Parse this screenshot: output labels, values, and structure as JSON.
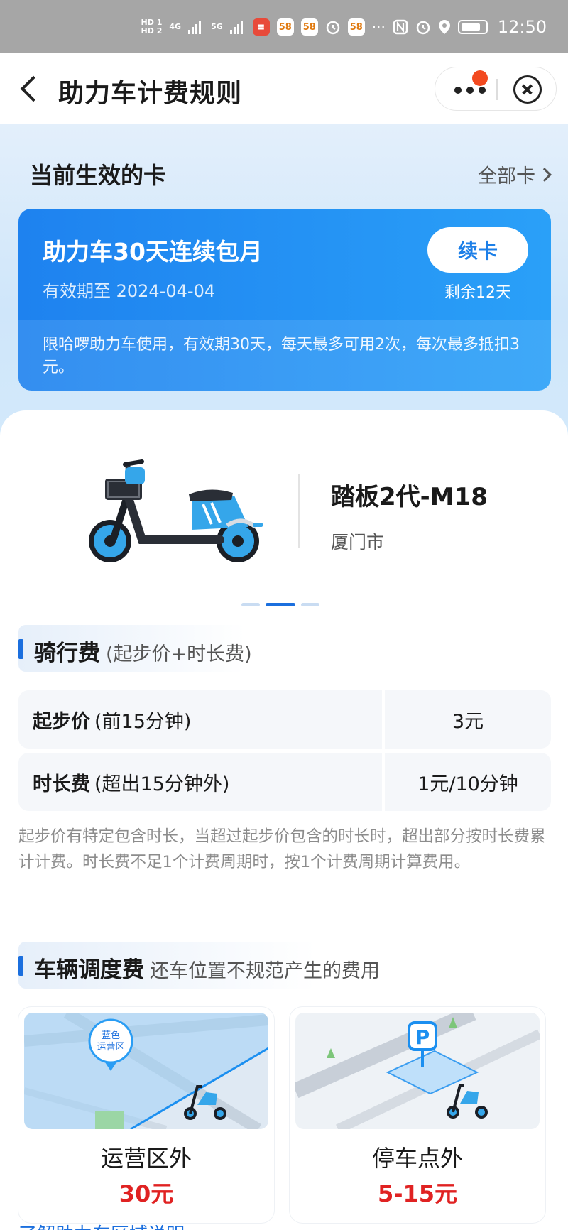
{
  "status_bar": {
    "hd1": "HD 1",
    "hd2": "HD 2",
    "net1": "4G",
    "net2": "5G",
    "app_badges": [
      "58",
      "58",
      "58"
    ],
    "more": "···",
    "time": "12:50"
  },
  "nav": {
    "title": "助力车计费规则"
  },
  "active_card": {
    "heading": "当前生效的卡",
    "all_cards_label": "全部卡",
    "title": "助力车30天连续包月",
    "valid_until": "有效期至 2024-04-04",
    "renew_label": "续卡",
    "remaining": "剩余12天",
    "description": "限哈啰助力车使用，有效期30天，每天最多可用2次，每次最多抵扣3元。"
  },
  "vehicle": {
    "model": "踏板2代-M18",
    "city": "厦门市"
  },
  "carousel": {
    "count": 3,
    "active_index": 1
  },
  "riding_fee": {
    "title": "骑行费",
    "subtitle": "(起步价+时长费)",
    "rows": [
      {
        "name": "起步价",
        "detail": "(前15分钟)",
        "value": "3元"
      },
      {
        "name": "时长费",
        "detail": "(超出15分钟外)",
        "value": "1元/10分钟"
      }
    ],
    "note": "起步价有特定包含时长，当超过起步价包含的时长时，超出部分按时长费累计计费。时长费不足1个计费周期时，按1个计费周期计算费用。"
  },
  "dispatch_fee": {
    "title": "车辆调度费",
    "subtitle": "还车位置不规范产生的费用",
    "cards": [
      {
        "name": "运营区外",
        "price": "30元",
        "map_label": "蓝色运营区",
        "icon": "map-pin-icon"
      },
      {
        "name": "停车点外",
        "price": "5-15元",
        "map_label": "P",
        "icon": "parking-sign-icon"
      }
    ]
  },
  "bottom_link": "了解助力车区域说明 >",
  "colors": {
    "brand_blue": "#1b6fde",
    "card_gradient_start": "#1e82ef",
    "card_gradient_end": "#2aa0f8",
    "price_red": "#e02222",
    "status_bar": "#a6a6a6"
  }
}
